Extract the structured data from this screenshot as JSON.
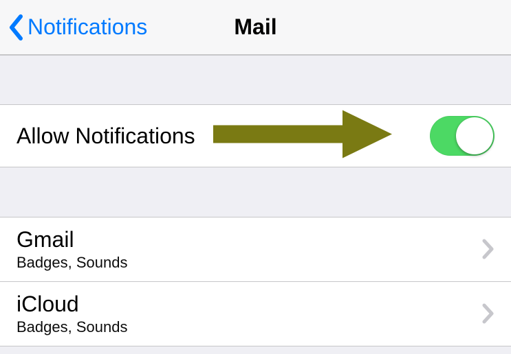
{
  "nav": {
    "back_label": "Notifications",
    "title": "Mail"
  },
  "allow_row": {
    "label": "Allow Notifications",
    "enabled": true
  },
  "accounts": [
    {
      "name": "Gmail",
      "detail": "Badges, Sounds"
    },
    {
      "name": "iCloud",
      "detail": "Badges, Sounds"
    }
  ],
  "colors": {
    "tint": "#007aff",
    "switch_on": "#4cd964",
    "annotation_arrow": "#7a7a13"
  }
}
